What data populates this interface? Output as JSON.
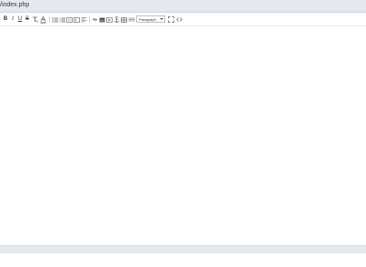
{
  "window": {
    "title": "/index.php"
  },
  "toolbar": {
    "format_value": "Paragraph",
    "bold_label": "B",
    "italic_label": "I",
    "underline_label": "U",
    "strike_label": "S"
  },
  "colors": {
    "titlebar_bg": "#e3e9ee",
    "statusbar_bg": "#e3e9ee",
    "icon": "#555555"
  }
}
